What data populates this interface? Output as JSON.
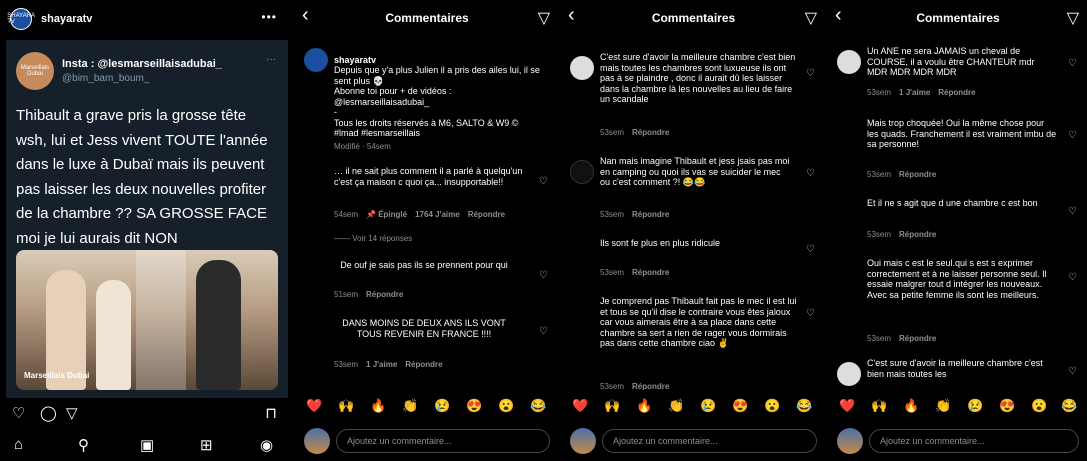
{
  "panel1": {
    "username": "shayaratv",
    "avatar_text": "SHAYARA TV",
    "more_icon": "ellipsis-icon",
    "tweet": {
      "name": "Insta : @lesmarseillaisadubai_",
      "handle": "@bim_bam_boum_",
      "avatar_text": "Marseillais Dubai",
      "text": "Thibault a grave pris la grosse tête wsh, lui et Jess vivent TOUTE l'année dans le luxe à Dubaï mais ils peuvent pas laisser les deux nouvelles profiter de la chambre ?? SA GROSSE FACE moi je lui aurais dit NON",
      "media_watermark": "Marseillais Dubai"
    },
    "actions": [
      "heart-icon",
      "comment-icon",
      "share-icon",
      "bookmark-icon"
    ],
    "nav": [
      "home-icon",
      "search-icon",
      "reels-icon",
      "shop-icon",
      "profile-icon"
    ]
  },
  "comments_header": {
    "title": "Commentaires",
    "back_icon": "back-chevron-icon",
    "filter_icon": "filter-icon"
  },
  "panel2": {
    "caption": {
      "user": "shayaratv",
      "text": "Depuis que y'a plus Julien il a pris des ailes lui, il se sent plus 💀\nAbonne toi pour + de vidéos : @lesmarseillaisadubai_\n-\nTous les droits réservés à M6, SALTO & W9 © #lmad #lesmarseillais",
      "meta": "Modifié · 54sem"
    },
    "comments": [
      {
        "text": "… il ne sait plus comment il a parlé à quelqu'un c'est ça maison c quoi ça... insupportable!!",
        "time": "54sem",
        "pinned": "📌 Épinglé",
        "likes": "1764 J'aime",
        "reply": "Répondre"
      },
      {
        "text": "De ouf je sais pas ils se prennent pour qui",
        "time": "51sem",
        "reply": "Répondre"
      },
      {
        "text": "DANS MOINS DE DEUX ANS ILS VONT TOUS REVENIR EN FRANCE !!!!",
        "time": "53sem",
        "likes": "1 J'aime",
        "reply": "Répondre"
      }
    ],
    "see_replies": "—— Voir 14 réponses"
  },
  "panel3": {
    "comments": [
      {
        "text": "C'est sure d'avoir la meilleure chambre c'est bien mais toutes les chambres sont luxueuse ils ont pas à se plaindre , donc il aurait dû les laisser dans la chambre là les nouvelles au lieu de faire un scandale",
        "time": "53sem",
        "reply": "Répondre"
      },
      {
        "text": "Nan mais imagine Thibault et jess jsais pas moi en camping ou quoi ils vas se suicider le mec ou c'est comment ?! 😂😂",
        "time": "53sem",
        "reply": "Répondre"
      },
      {
        "text": "Ils sont fe plus en plus ridicule",
        "time": "53sem",
        "reply": "Répondre"
      },
      {
        "text": "Je comprend pas Thibault fait pas le mec il est lui et tous se qu'il dise le contraire vous êtes jaloux car vous aimerais être à sa place dans cette chambre sa sert a rien de rager vous dormirais pas dans cette chambre ciao ✌️",
        "time": "53sem",
        "reply": "Répondre"
      }
    ]
  },
  "panel4": {
    "comments": [
      {
        "text": "Un ANE ne sera JAMAIS un cheval de COURSE, il a voulu être CHANTEUR mdr MDR MDR MDR MDR",
        "time": "53sem",
        "likes": "1 J'aime",
        "reply": "Répondre"
      },
      {
        "text": "Mais trop choquée! Oui la même chose pour les quads. Franchement il est vraiment imbu de sa personne!",
        "time": "53sem",
        "reply": "Répondre"
      },
      {
        "text": "Et il ne s agit que d une chambre c est bon",
        "time": "53sem",
        "reply": "Répondre"
      },
      {
        "text": "Oui mais c est le seul.qui s est s exprimer correctement et à ne laisser personne seul. Il essaie malgrer tout d intégrer les nouveaux. Avec sa petite femme ils sont les meilleurs.",
        "time": "53sem",
        "reply": "Répondre"
      },
      {
        "text": "C'est sure d'avoir la meilleure chambre c'est bien mais toutes les",
        "time": "",
        "reply": ""
      }
    ]
  },
  "emoji_bar": [
    "❤️",
    "🙌",
    "🔥",
    "👏",
    "😢",
    "😍",
    "😮",
    "😂"
  ],
  "add_comment_placeholder": "Ajoutez un commentaire..."
}
